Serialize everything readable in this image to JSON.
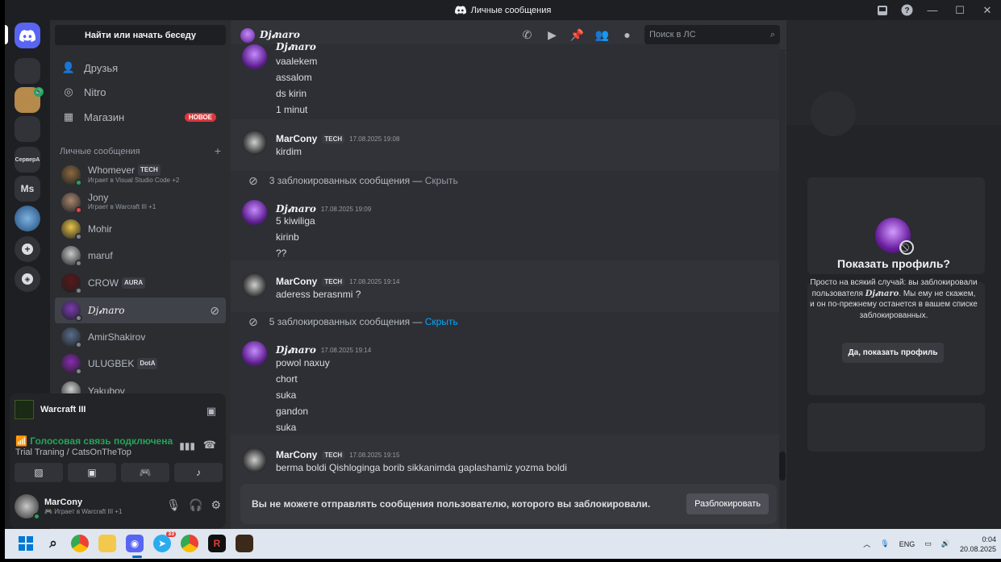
{
  "window": {
    "title": "Личные сообщения"
  },
  "rail": {
    "server_label_a": "СерверА",
    "server_label_ms": "Ms"
  },
  "sidebar": {
    "search_label": "Найти или начать беседу",
    "nav": [
      {
        "label": "Друзья",
        "icon": "friends-icon"
      },
      {
        "label": "Nitro",
        "icon": "nitro-icon"
      },
      {
        "label": "Магазин",
        "icon": "shop-icon",
        "badge": "НОВОЕ"
      }
    ],
    "dm_header": "Личные сообщения",
    "dms": [
      {
        "name": "Whomever",
        "tag": "TECH",
        "sub": "Играет в Visual Studio Code +2",
        "status": "online",
        "color": "#8b6a3e"
      },
      {
        "name": "Jony",
        "tag": "",
        "sub": "Играет в Warcraft III +1",
        "status": "dnd",
        "color": "#a9876d"
      },
      {
        "name": "Mohir",
        "tag": "",
        "sub": "",
        "status": "offline",
        "color": "#e8c447"
      },
      {
        "name": "maruf",
        "tag": "",
        "sub": "",
        "status": "offline",
        "color": "#c9c9c9"
      },
      {
        "name": "CROW",
        "tag": "AURA",
        "sub": "",
        "status": "offline",
        "color": "#5a1818"
      },
      {
        "name": "Dj𝓲naro",
        "tag": "",
        "sub": "",
        "status": "offline",
        "color": "#7a3bb0"
      },
      {
        "name": "AmirShakirov",
        "tag": "",
        "sub": "",
        "status": "offline",
        "color": "#5a6d8a"
      },
      {
        "name": "ULUGBEK",
        "tag": "DotA",
        "sub": "",
        "status": "offline",
        "color": "#8a2bb0"
      },
      {
        "name": "Yakubov",
        "tag": "",
        "sub": "",
        "status": "offline",
        "color": "#d0d0d0"
      }
    ]
  },
  "voice": {
    "game": "Warcraft III",
    "status": "Голосовая связь подключена",
    "channel": "Trial Traning / CatsOnTheTop"
  },
  "user": {
    "name": "MarCony",
    "sub": "Играет в Warcraft III +1"
  },
  "chat": {
    "header_name": "Dj𝓲naro",
    "search_placeholder": "Поиск в ЛС",
    "groups": [
      {
        "author": "Dj𝓲naro",
        "time": "",
        "lines": [
          "vaalekem",
          "assalom",
          "ds kirin",
          "1 minut"
        ]
      },
      {
        "author": "MarCony",
        "tag": "TECH",
        "time": "17.08.2025 19:08",
        "lines": [
          "kirdim"
        ]
      },
      {
        "blocked_text": "3 заблокированных сообщения —",
        "hide": "Скрыть"
      },
      {
        "author": "Dj𝓲naro",
        "time": "17.08.2025 19:09",
        "lines": [
          "5 kiwiliga",
          "kirinb",
          "??"
        ]
      },
      {
        "author": "MarCony",
        "tag": "TECH",
        "time": "17.08.2025 19:14",
        "lines": [
          "aderess berasnmi  ?"
        ]
      },
      {
        "blocked_text": "5 заблокированных сообщения —",
        "hide": "Скрыть"
      },
      {
        "author": "Dj𝓲naro",
        "time": "17.08.2025 19:14",
        "lines": [
          "powol naxuy",
          "chort",
          "suka",
          "gandon",
          "suka"
        ]
      },
      {
        "author": "MarCony",
        "tag": "TECH",
        "time": "17.08.2025 19:15",
        "lines": [
          "berma boldi Qishloginga borib  sikkanimda gaplashamiz yozma boldi"
        ]
      }
    ],
    "composer_text": "Вы не можете отправлять сообщения пользователю, которого вы заблокировали.",
    "unblock_label": "Разблокировать"
  },
  "profile": {
    "title": "Показать профиль?",
    "desc_1": "Просто на всякий случай: вы заблокировали пользователя",
    "desc_name": "Dj𝓲naro",
    "desc_2": ". Мы ему не скажем, и он по-прежнему останется в вашем списке заблокированных.",
    "button": "Да, показать профиль"
  },
  "taskbar": {
    "lang": "ENG",
    "time": "0:04",
    "date": "20.08.2025",
    "telegram_badge": "33"
  },
  "colors": {
    "blurple": "#5865f2",
    "online": "#23a55a",
    "dnd": "#f23f43",
    "badge_red": "#da373c",
    "link_blue": "#00a8fc"
  }
}
